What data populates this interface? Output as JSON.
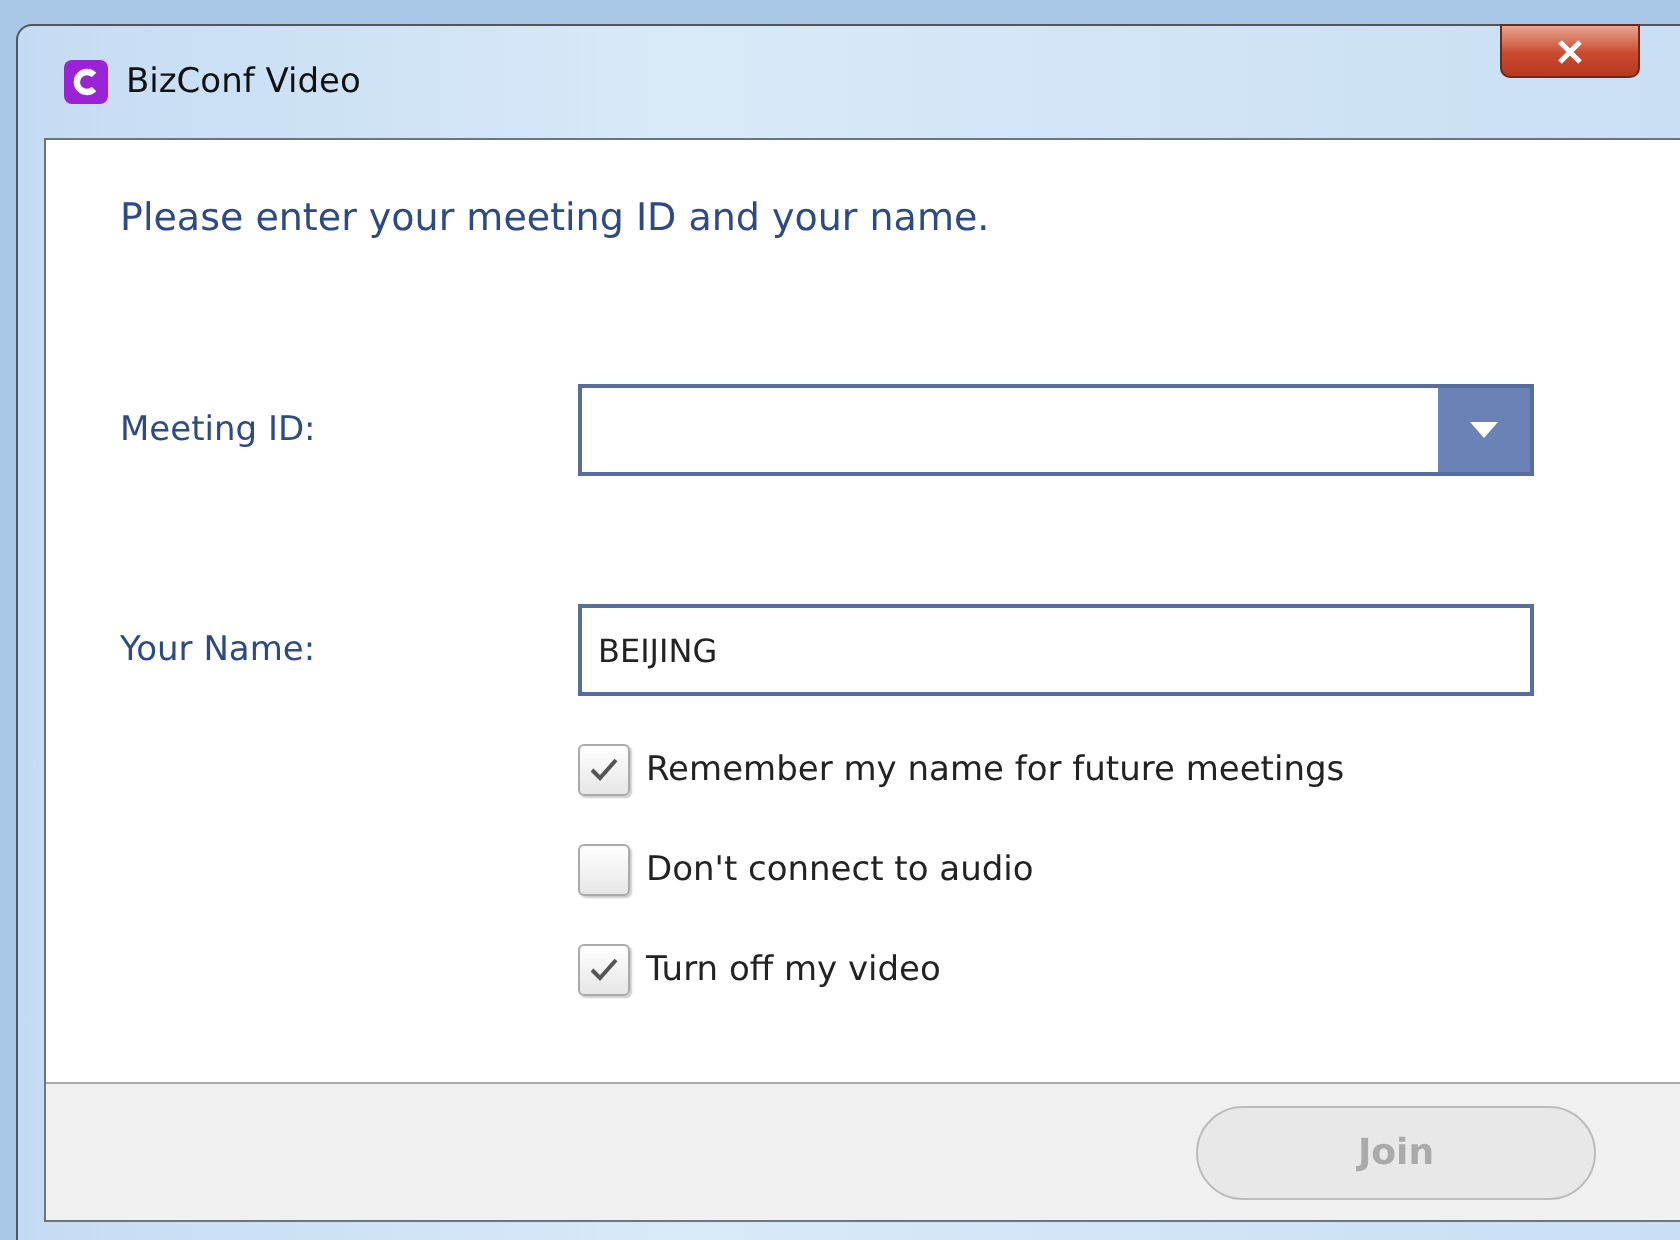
{
  "window": {
    "title": "BizConf Video"
  },
  "heading": "Please enter your meeting ID and your name.",
  "meeting_id": {
    "label": "Meeting ID:"
  },
  "name": {
    "label": "Your Name:",
    "value": "BEIJING"
  },
  "options": [
    {
      "label": "Remember my name for future meetings",
      "checked": true
    },
    {
      "label": "Don't connect to audio",
      "checked": false
    },
    {
      "label": "Turn off my video",
      "checked": true
    }
  ],
  "join_button": {
    "label": "Join",
    "disabled": true
  }
}
